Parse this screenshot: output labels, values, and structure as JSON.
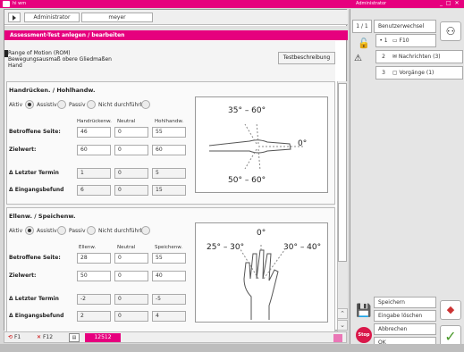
{
  "topbar": {
    "left_title": "hi wm",
    "right_title": "Administrator",
    "window_controls": "_ □ ✕"
  },
  "toolbar": {
    "user_role": "Administrator",
    "user_name": "meyer"
  },
  "title": "Assessment-Test anlegen / bearbeiten",
  "header_info": {
    "line1": "Range of Motion (ROM)",
    "line2": "Bewegungsausmaß obere Gliedmaßen",
    "line3": "Hand"
  },
  "test_button": "Testbeschreibung",
  "section1": {
    "title": "Handrücken.  / Hohlhandw.",
    "modes": [
      "Aktiv",
      "Assistiv",
      "Passiv",
      "Nicht durchführbar"
    ],
    "selected_mode": "Assistiv",
    "columns": [
      "Handrückenw.",
      "Neutral",
      "Hohlhandw."
    ],
    "rows": [
      {
        "label": "Betroffene Seite:",
        "values": [
          "46",
          "0",
          "55"
        ]
      },
      {
        "label": "Zielwert:",
        "values": [
          "60",
          "0",
          "60"
        ]
      },
      {
        "label": "Δ Letzter Termin",
        "values": [
          "1",
          "0",
          "5"
        ]
      },
      {
        "label": "Δ Eingangsbefund",
        "values": [
          "6",
          "0",
          "15"
        ]
      }
    ],
    "image_labels": {
      "top": "35° – 60°",
      "right": "0°",
      "bottom": "50° – 60°"
    }
  },
  "section2": {
    "title": "Ellenw.  / Speichenw.",
    "modes": [
      "Aktiv",
      "Assistiv",
      "Passiv",
      "Nicht durchführbar"
    ],
    "selected_mode": "Aktiv",
    "columns": [
      "Ellenw.",
      "Neutral",
      "Speichenw."
    ],
    "rows": [
      {
        "label": "Betroffene Seite:",
        "values": [
          "28",
          "0",
          "55"
        ]
      },
      {
        "label": "Zielwert:",
        "values": [
          "50",
          "0",
          "40"
        ]
      },
      {
        "label": "Δ Letzter Termin",
        "values": [
          "-2",
          "0",
          "-5"
        ]
      },
      {
        "label": "Δ Eingangsbefund",
        "values": [
          "2",
          "0",
          "4"
        ]
      }
    ],
    "image_labels": {
      "top": "0°",
      "left": "25° – 30°",
      "right": "30° – 40°"
    }
  },
  "statusbar": {
    "f1": "F1",
    "f12": "F12",
    "field": "12512"
  },
  "rightpanel": {
    "page": "1 / 1",
    "user_switch": "Benutzerwechsel",
    "tabs": [
      {
        "num": "• 1",
        "label": "F10"
      },
      {
        "num": "2",
        "label": "Nachrichten (3)"
      },
      {
        "num": "3",
        "label": "Vorgänge (1)"
      }
    ],
    "save": "Speichern",
    "clear": "Eingabe löschen",
    "cancel": "Abbrechen",
    "ok": "OK",
    "stop": "Stop"
  },
  "colors": {
    "accent": "#e6007e"
  }
}
